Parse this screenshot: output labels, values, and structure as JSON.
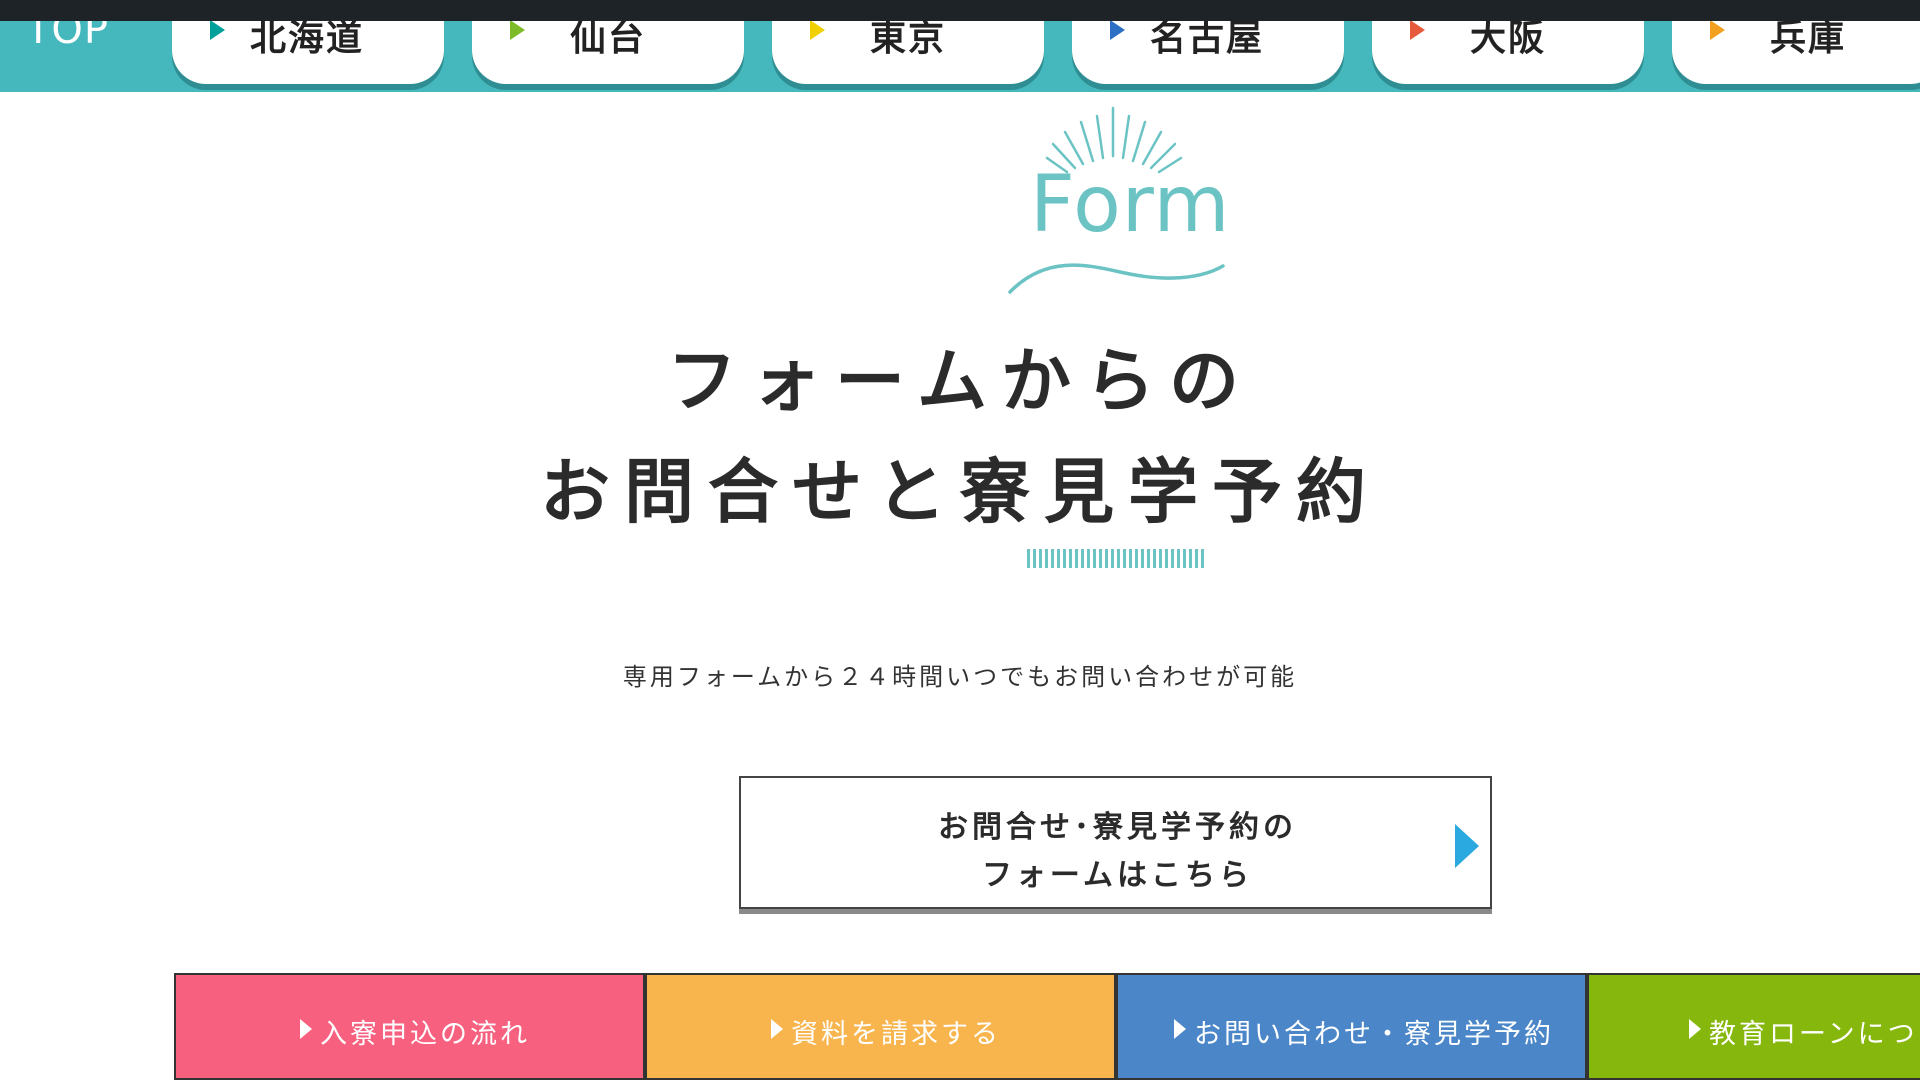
{
  "nav": {
    "top_label": "TOP",
    "tabs": [
      {
        "label": "北海道",
        "color": "#00a09a"
      },
      {
        "label": "仙台",
        "color": "#7dbb28"
      },
      {
        "label": "東京",
        "color": "#f0d000"
      },
      {
        "label": "名古屋",
        "color": "#2d6fc4"
      },
      {
        "label": "大阪",
        "color": "#e65a3c"
      },
      {
        "label": "兵庫",
        "color": "#f2a020"
      }
    ]
  },
  "section": {
    "en_title": "Form",
    "title_line1": "フォームからの",
    "title_line2": "お問合せと寮見学予約",
    "description": "専用フォームから２４時間いつでもお問い合わせが可能"
  },
  "cta": {
    "line1": "お問合せ･寮見学予約の",
    "line2": "フォームはこちら",
    "arrow_icon": "arrow-right-icon",
    "arrow_color": "#2aa9e0"
  },
  "bottom_buttons": [
    {
      "label": "入寮申込の流れ",
      "color": "#f7617f"
    },
    {
      "label": "資料を請求する",
      "color": "#f8b54e"
    },
    {
      "label": "お問い合わせ・寮見学予約",
      "color": "#4a86c8"
    },
    {
      "label": "教育ローンについ",
      "color": "#86b70c"
    }
  ],
  "colors": {
    "nav_bg": "#45b8bd",
    "accent": "#6cc3c4"
  }
}
